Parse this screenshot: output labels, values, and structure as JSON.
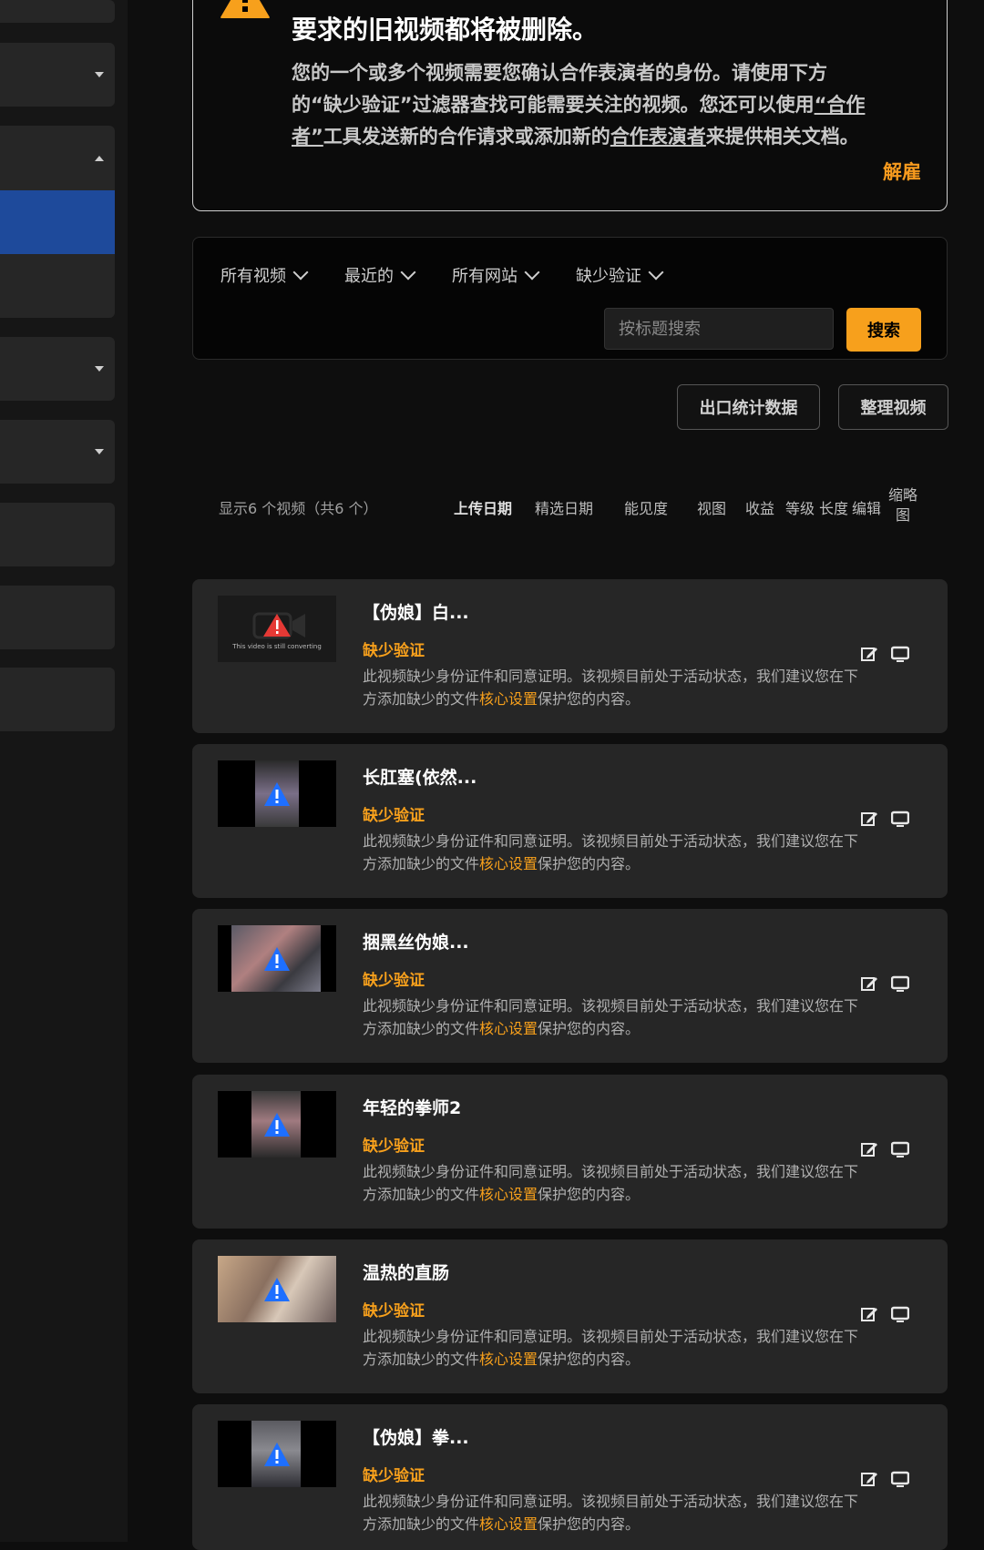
{
  "notice": {
    "title": "要求的旧视频都将被删除。",
    "body_1": "您的一个或多个视频需要您确认合作表演者的身份。请使用下方的“缺少验证”过滤器查找可能需要关注的视频。您还可以使用",
    "body_link_1": "“合作者”",
    "body_2": "工具发送新的合作请求或添加新的",
    "body_link_2": "合作表演者",
    "body_3": "来提供相关文档。",
    "dismiss_label": "解雇"
  },
  "filters": {
    "all_videos": "所有视频",
    "recent": "最近的",
    "all_sites": "所有网站",
    "missing_verification": "缺少验证",
    "search_placeholder": "按标题搜索",
    "search_button": "搜索"
  },
  "actions": {
    "export_stats": "出口统计数据",
    "organize_videos": "整理视频"
  },
  "list_header": {
    "count_text": "显示6 个视频（共6 个）",
    "columns": [
      "上传日期",
      "精选日期",
      "能见度",
      "视图",
      "收益",
      "等级",
      "长度",
      "编辑",
      "缩略图"
    ]
  },
  "status_label": "缺少验证",
  "desc_prefix": "此视频缺少身份证件和同意证明。该视频目前处于活动状态，我们建议您在下方添加缺少的文件",
  "desc_link": "核心设置",
  "desc_suffix": "保护您的内容。",
  "converting_text": "This video is still converting",
  "videos": [
    {
      "title": "【伪娘】白..."
    },
    {
      "title": "长肛塞(依然..."
    },
    {
      "title": "捆黑丝伪娘..."
    },
    {
      "title": "年轻的拳师2"
    },
    {
      "title": "温热的直肠"
    },
    {
      "title": "【伪娘】拳..."
    }
  ],
  "colors": {
    "accent": "#f7a01c",
    "sidebar_active": "#1e4a9b",
    "warning_red": "#e53935",
    "overlay_blue": "#1e6fff"
  },
  "icons": [
    "warning-icon",
    "chevron-down-icon",
    "edit-icon",
    "monitor-icon",
    "caret-down-icon",
    "caret-up-icon"
  ]
}
